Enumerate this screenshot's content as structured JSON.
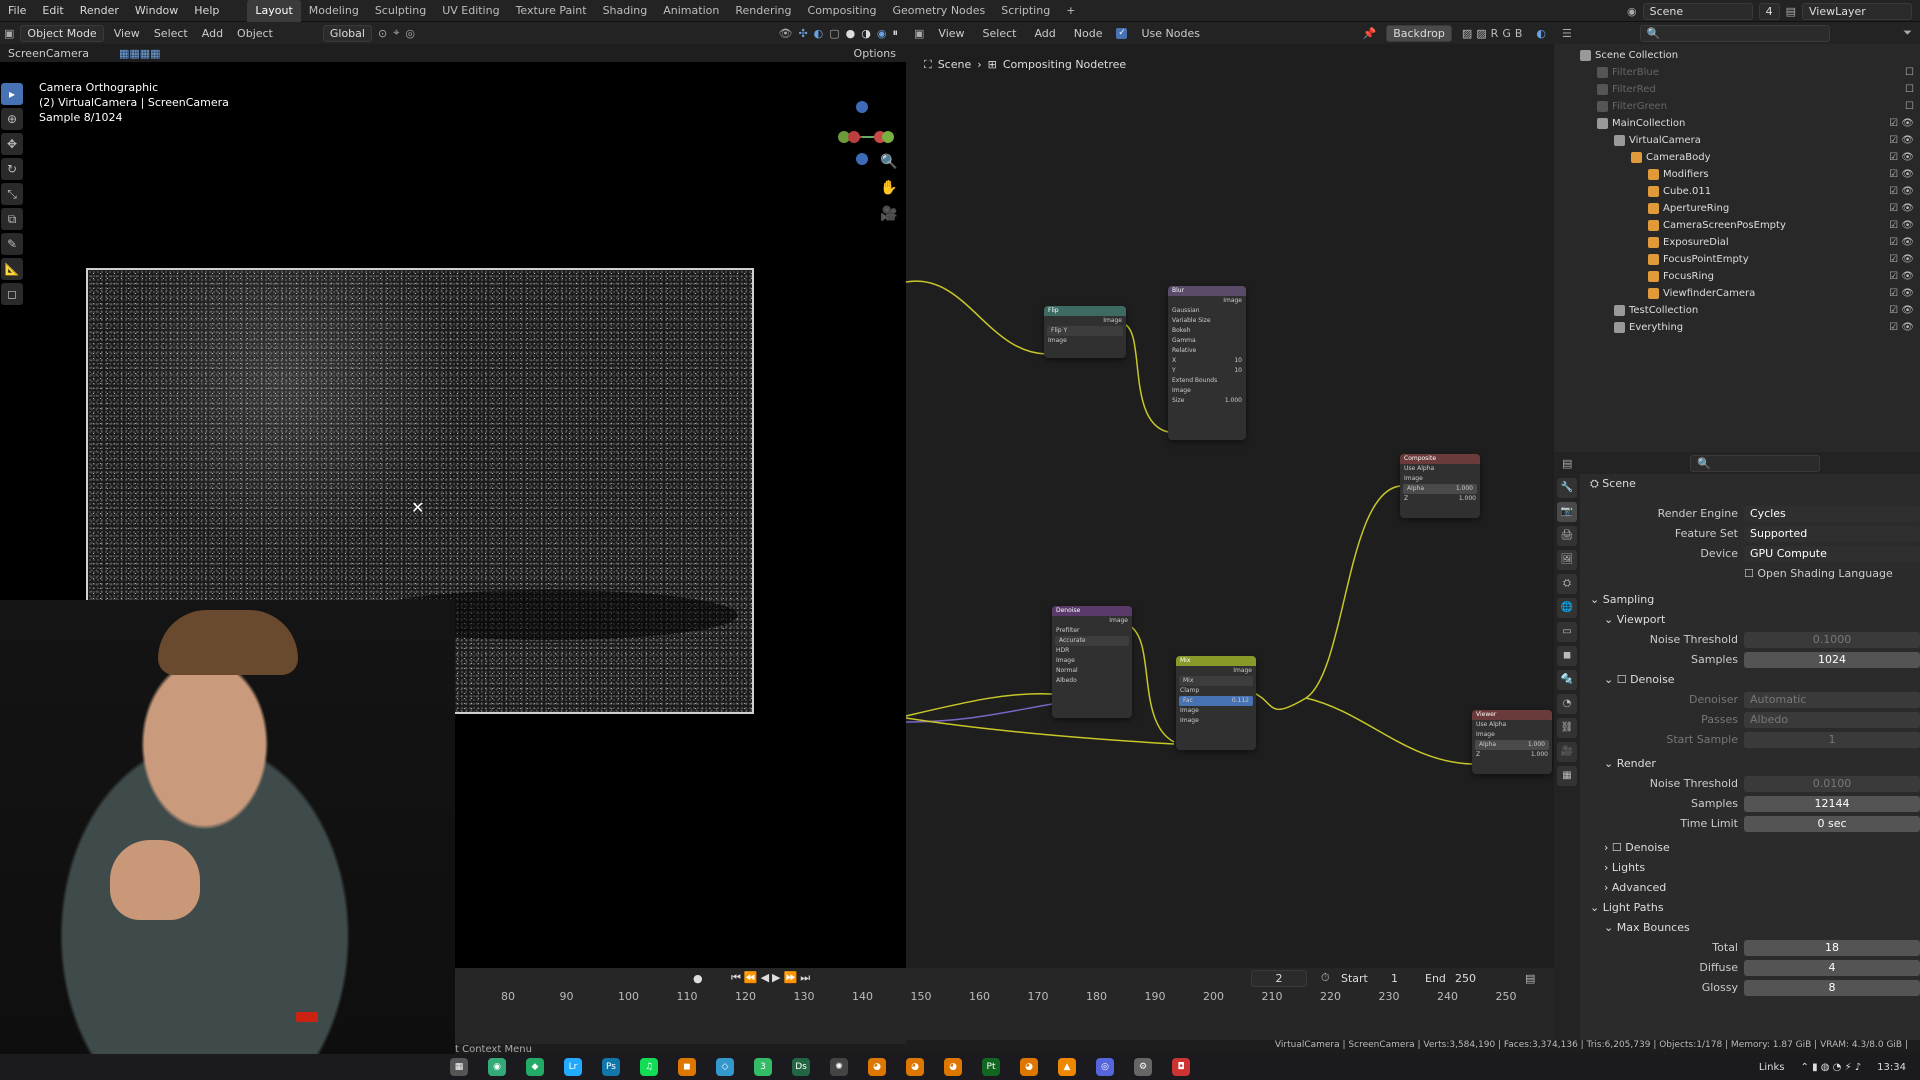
{
  "menu": [
    "File",
    "Edit",
    "Render",
    "Window",
    "Help"
  ],
  "workspaces": [
    "Layout",
    "Modeling",
    "Sculpting",
    "UV Editing",
    "Texture Paint",
    "Shading",
    "Animation",
    "Rendering",
    "Compositing",
    "Geometry Nodes",
    "Scripting"
  ],
  "active_workspace": "Layout",
  "topbar_right": {
    "scene": "Scene",
    "scene_count": "4",
    "view_layer": "ViewLayer"
  },
  "viewport": {
    "mode": "Object Mode",
    "view": "View",
    "select": "Select",
    "add": "Add",
    "object": "Object",
    "transform": "Global",
    "options": "Options",
    "camera_select": "ScreenCamera",
    "overlay_line1": "Camera Orthographic",
    "overlay_line2": "(2) VirtualCamera | ScreenCamera",
    "overlay_line3": "Sample 8/1024"
  },
  "node_editor": {
    "view": "View",
    "select": "Select",
    "add": "Add",
    "node": "Node",
    "use_nodes": "Use Nodes",
    "backdrop": "Backdrop",
    "breadcrumb_scene": "Scene",
    "breadcrumb_tree": "Compositing Nodetree"
  },
  "timeline": {
    "current_frame": "2",
    "start_label": "Start",
    "start_value": "1",
    "end_label": "End",
    "end_value": "250",
    "ticks": [
      "80",
      "90",
      "100",
      "110",
      "120",
      "130",
      "140",
      "150",
      "160",
      "170",
      "180",
      "190",
      "200",
      "210",
      "220",
      "230",
      "240",
      "250"
    ],
    "status_left": "t Context Menu"
  },
  "outliner": {
    "root": "Scene Collection",
    "items": [
      {
        "name": "FilterBlue",
        "depth": 1,
        "dim": true
      },
      {
        "name": "FilterRed",
        "depth": 1,
        "dim": true
      },
      {
        "name": "FilterGreen",
        "depth": 1,
        "dim": true
      },
      {
        "name": "MainCollection",
        "depth": 1,
        "dim": false
      },
      {
        "name": "VirtualCamera",
        "depth": 2,
        "dim": false
      },
      {
        "name": "CameraBody",
        "depth": 3,
        "dim": false
      },
      {
        "name": "Modifiers",
        "depth": 4,
        "dim": false
      },
      {
        "name": "Cube.011",
        "depth": 4,
        "dim": false
      },
      {
        "name": "ApertureRing",
        "depth": 4,
        "dim": false
      },
      {
        "name": "CameraScreenPosEmpty",
        "depth": 4,
        "dim": false
      },
      {
        "name": "ExposureDial",
        "depth": 4,
        "dim": false
      },
      {
        "name": "FocusPointEmpty",
        "depth": 4,
        "dim": false
      },
      {
        "name": "FocusRing",
        "depth": 4,
        "dim": false
      },
      {
        "name": "ViewfinderCamera",
        "depth": 4,
        "dim": false
      },
      {
        "name": "TestCollection",
        "depth": 2,
        "dim": false
      },
      {
        "name": "Everything",
        "depth": 2,
        "dim": false
      }
    ]
  },
  "properties": {
    "scene": "Scene",
    "render_engine_label": "Render Engine",
    "render_engine": "Cycles",
    "feature_set_label": "Feature Set",
    "feature_set": "Supported",
    "device_label": "Device",
    "device": "GPU Compute",
    "osl_label": "Open Shading Language",
    "sampling": "Sampling",
    "viewport": "Viewport",
    "noise_threshold_label": "Noise Threshold",
    "viewport_noise": "0.1000",
    "samples_label": "Samples",
    "viewport_samples": "1024",
    "denoise": "Denoise",
    "denoiser_label": "Denoiser",
    "denoiser": "Automatic",
    "passes_label": "Passes",
    "passes": "Albedo",
    "start_sample_label": "Start Sample",
    "start_sample": "1",
    "render": "Render",
    "render_noise": "0.0100",
    "render_samples": "12144",
    "time_limit_label": "Time Limit",
    "time_limit": "0 sec",
    "render_denoise": "Denoise",
    "lights": "Lights",
    "advanced": "Advanced",
    "light_paths": "Light Paths",
    "max_bounces": "Max Bounces",
    "total_label": "Total",
    "total": "18",
    "diffuse_label": "Diffuse",
    "diffuse": "4",
    "glossy_label": "Glossy",
    "glossy": "8"
  },
  "nodes": {
    "flip_title": "Flip",
    "flip_image": "Image",
    "flip_axis": "Flip Y",
    "flip_in": "Image",
    "blur_title": "Blur",
    "blur_out": "Image",
    "blur_type": "Gaussian",
    "blur_opt1": "Variable Size",
    "blur_opt2": "Bokeh",
    "blur_opt3": "Gamma",
    "blur_opt4": "Relative",
    "blur_x": "X",
    "blur_x_val": "10",
    "blur_y": "Y",
    "blur_y_val": "10",
    "blur_ext": "Extend Bounds",
    "blur_in": "Image",
    "blur_size": "Size",
    "blur_size_val": "1.000",
    "composite_title": "Composite",
    "use_alpha": "Use Alpha",
    "comp_image": "Image",
    "alpha": "Alpha",
    "alpha_val": "1.000",
    "z": "Z",
    "z_val": "1.000",
    "denoise_title": "Denoise",
    "den_image_out": "Image",
    "prefilter": "Prefilter",
    "prefilter_val": "Accurate",
    "hdr": "HDR",
    "den_image": "Image",
    "den_normal": "Normal",
    "den_albedo": "Albedo",
    "mix_title": "Mix",
    "mix_out": "Image",
    "mix_mode": "Mix",
    "clamp": "Clamp",
    "fac": "Fac",
    "fac_val": "0.112",
    "mix_in1": "Image",
    "mix_in2": "Image",
    "viewer_title": "Viewer",
    "viewer_alpha_val": "1.000",
    "viewer_z_val": "1.000"
  },
  "statusbar": "VirtualCamera | ScreenCamera | Verts:3,584,190 | Faces:3,374,136 | Tris:6,205,739 | Objects:1/178 | Memory: 1.87 GiB | VRAM: 4.3/8.0 GiB |",
  "taskbar": {
    "links": "Links",
    "time": "13:34"
  },
  "colors": {
    "accent": "#4772b3",
    "node_link": "#c7c729",
    "active_tab": "#3b3b3b"
  }
}
